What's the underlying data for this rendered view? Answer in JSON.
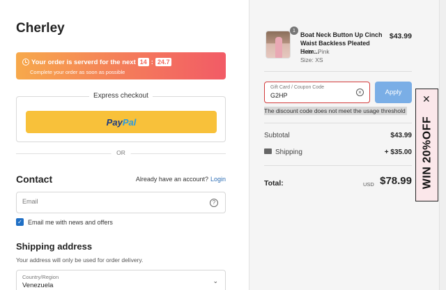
{
  "brand": "Cherley",
  "timer": {
    "text": "Your order is serverd for the next",
    "minutes": "14",
    "seconds": "24.7",
    "subtext": "Complete your order as soon as possible"
  },
  "express": {
    "legend": "Express checkout",
    "paypal_part1": "Pay",
    "paypal_part2": "Pal"
  },
  "divider_or": "OR",
  "contact": {
    "heading": "Contact",
    "have_account": "Already have an account?",
    "login_label": "Login",
    "email_placeholder": "Email",
    "email_value": "",
    "newsletter_label": "Email me with news and offers",
    "newsletter_checked": true
  },
  "shipping": {
    "heading": "Shipping address",
    "note": "Your address will only be used for order delivery.",
    "country_label": "Country/Region",
    "country_value": "Venezuela"
  },
  "cart": {
    "item": {
      "qty": "1",
      "title": "Boat Neck Button Up Cinch Waist Backless Pleated Hem...",
      "color": "Color: Pink",
      "size": "Size: XS",
      "price": "$43.99"
    },
    "coupon": {
      "label": "Gift Card / Coupon Code",
      "value": "G2HP",
      "apply_label": "Apply",
      "error": "The discount code does not meet the usage threshold"
    },
    "subtotal_label": "Subtotal",
    "subtotal_value": "$43.99",
    "shipping_label": "Shipping",
    "shipping_value": "+ $35.00",
    "total_label": "Total:",
    "total_currency": "USD",
    "total_value": "$78.99"
  },
  "promo": {
    "text": "WIN 20%OFF",
    "close": "✕"
  },
  "colors": {
    "accent_link": "#2f6fb6",
    "apply_button": "#7aaee6",
    "paypal_yellow": "#f8c13a",
    "error_border": "#d23a3a",
    "timer_gradient_start": "#f7a94b",
    "timer_gradient_end": "#f25b66"
  }
}
